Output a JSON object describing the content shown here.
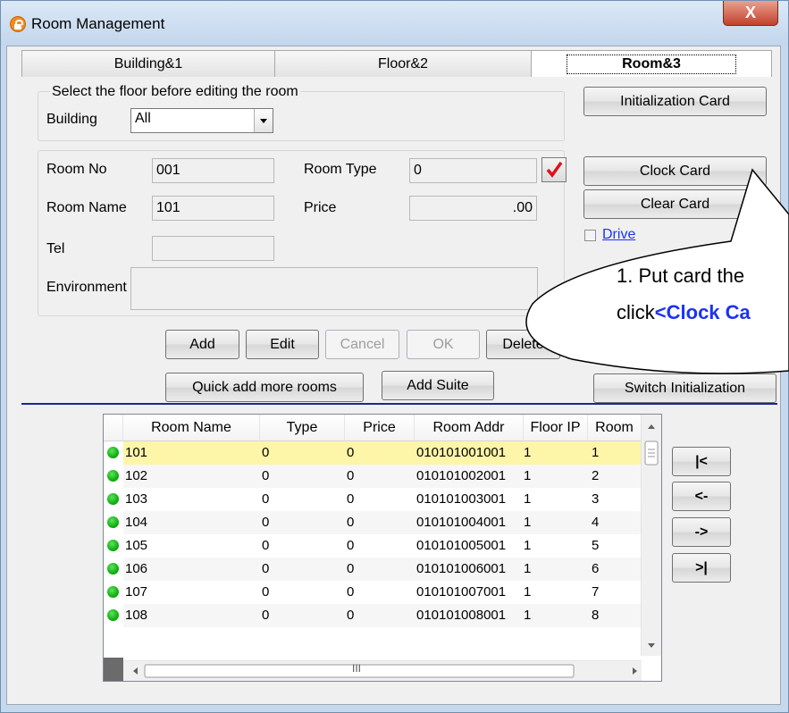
{
  "window": {
    "title": "Room Management",
    "close_label": "X"
  },
  "tabs": [
    "Building&1",
    "Floor&2",
    "Room&3"
  ],
  "floor_group": {
    "legend": "Select the floor before editing the room",
    "building_label": "Building",
    "building_value": "All"
  },
  "room": {
    "room_no_label": "Room No",
    "room_no": "001",
    "room_type_label": "Room Type",
    "room_type": "0",
    "room_name_label": "Room Name",
    "room_name": "101",
    "price_label": "Price",
    "price": ".00",
    "tel_label": "Tel",
    "tel": "",
    "environment_label": "Environment",
    "environment": ""
  },
  "right_buttons": {
    "init_card": "Initialization Card",
    "clock_card": "Clock Card",
    "clear_card": "Clear Card",
    "drive_label": "Drive",
    "switch_init": "Switch Initialization"
  },
  "actions": {
    "add": "Add",
    "edit": "Edit",
    "cancel": "Cancel",
    "ok": "OK",
    "delete": "Delete",
    "quick_add": "Quick add more rooms",
    "add_suite": "Add Suite"
  },
  "table": {
    "columns": [
      "Room Name",
      "Type",
      "Price",
      "Room Addr",
      "Floor IP",
      "Room"
    ],
    "rows": [
      [
        "101",
        "0",
        "0",
        "010101001001",
        "1",
        "1"
      ],
      [
        "102",
        "0",
        "0",
        "010101002001",
        "1",
        "2"
      ],
      [
        "103",
        "0",
        "0",
        "010101003001",
        "1",
        "3"
      ],
      [
        "104",
        "0",
        "0",
        "010101004001",
        "1",
        "4"
      ],
      [
        "105",
        "0",
        "0",
        "010101005001",
        "1",
        "5"
      ],
      [
        "106",
        "0",
        "0",
        "010101006001",
        "1",
        "6"
      ],
      [
        "107",
        "0",
        "0",
        "010101007001",
        "1",
        "7"
      ],
      [
        "108",
        "0",
        "0",
        "010101008001",
        "1",
        "8"
      ]
    ],
    "hscroll_grip": "III"
  },
  "nav": {
    "first": "|<",
    "prev": "<-",
    "next": "->",
    "last": ">|"
  },
  "callout": {
    "line1": "1. Put card the",
    "line2_prefix": "click",
    "line2_highlight": "<Clock Ca"
  },
  "colors": {
    "selected_row": "#fdf5a8",
    "status_dot": "#18b418",
    "separator": "#1a2a8c",
    "callout_blue": "#1c32f5"
  }
}
